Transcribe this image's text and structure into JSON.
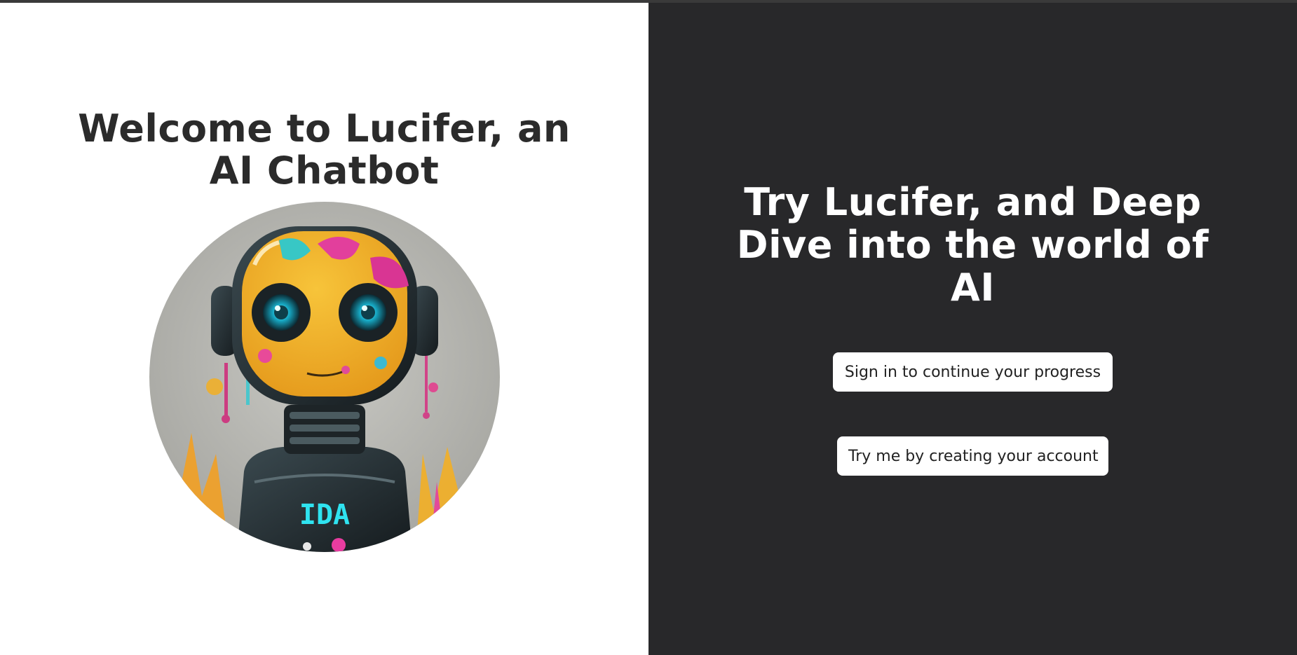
{
  "left": {
    "title": "Welcome to Lucifer, an AI Chatbot",
    "avatar": {
      "icon": "robot-avatar-icon",
      "chest_text": "IDA"
    }
  },
  "right": {
    "title": "Try Lucifer, and Deep Dive into the world of AI",
    "signin_label": "Sign in to continue your progress",
    "signup_label": "Try me by creating your account"
  },
  "colors": {
    "left_bg": "#ffffff",
    "right_bg": "#28282a",
    "title_dark": "#2b2b2b",
    "title_light": "#ffffff",
    "button_bg": "#ffffff"
  }
}
